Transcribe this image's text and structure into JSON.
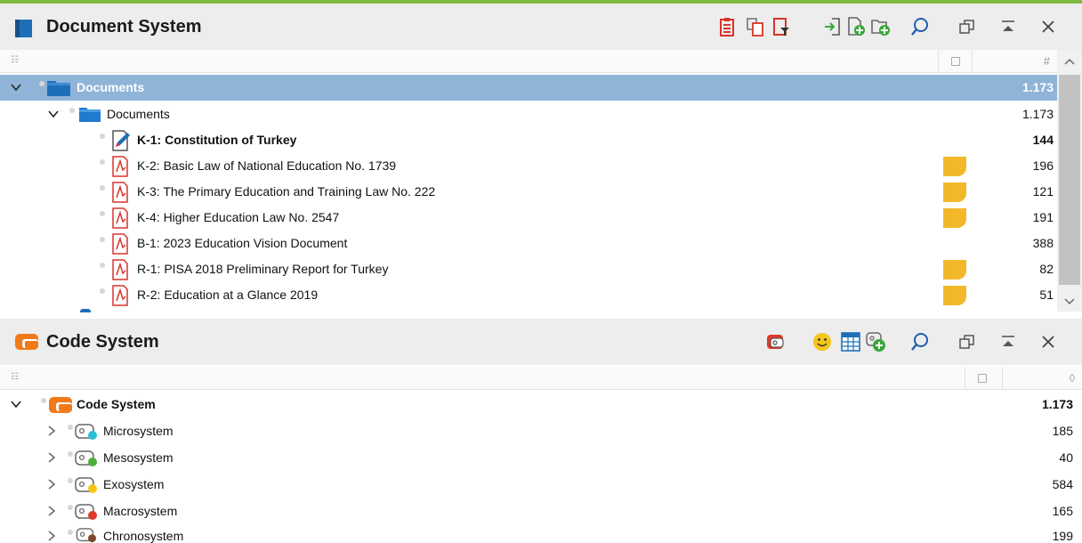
{
  "document_system": {
    "title": "Document System",
    "toolbar": [
      "clipboard-icon",
      "copy-icon",
      "filter-icon",
      "import-icon",
      "new-document-icon",
      "new-set-icon",
      "search-icon",
      "undock-icon",
      "collapse-icon",
      "close-icon"
    ],
    "column_count_header": "#",
    "root": {
      "label": "Documents",
      "count": "1.173"
    },
    "group": {
      "label": "Documents",
      "count": "1.173"
    },
    "documents": [
      {
        "label": "K-1: Constitution of Turkey",
        "count": "144",
        "memo": false,
        "bold": true,
        "icon": "edit-document-icon"
      },
      {
        "label": "K-2: Basic Law of National Education No. 1739",
        "count": "196",
        "memo": true,
        "bold": false,
        "icon": "pdf-icon"
      },
      {
        "label": "K-3: The Primary Education and Training Law No. 222",
        "count": "121",
        "memo": true,
        "bold": false,
        "icon": "pdf-icon"
      },
      {
        "label": "K-4: Higher Education Law No. 2547",
        "count": "191",
        "memo": true,
        "bold": false,
        "icon": "pdf-icon"
      },
      {
        "label": "B-1: 2023 Education Vision Document",
        "count": "388",
        "memo": false,
        "bold": false,
        "icon": "pdf-icon"
      },
      {
        "label": "R-1: PISA 2018 Preliminary Report for Turkey",
        "count": "82",
        "memo": true,
        "bold": false,
        "icon": "pdf-icon"
      },
      {
        "label": "R-2: Education at a Glance 2019",
        "count": "51",
        "memo": true,
        "bold": false,
        "icon": "pdf-icon"
      }
    ]
  },
  "code_system": {
    "title": "Code System",
    "toolbar": [
      "code-icon",
      "smiley-icon",
      "grid-icon",
      "new-code-icon",
      "search-icon",
      "undock-icon",
      "collapse-icon",
      "close-icon"
    ],
    "root": {
      "label": "Code System",
      "count": "1.173"
    },
    "codes": [
      {
        "label": "Microsystem",
        "count": "185",
        "color": "#2bc0d4"
      },
      {
        "label": "Mesosystem",
        "count": "40",
        "color": "#4caf3a"
      },
      {
        "label": "Exosystem",
        "count": "584",
        "color": "#f5c518"
      },
      {
        "label": "Macrosystem",
        "count": "165",
        "color": "#e0382b"
      },
      {
        "label": "Chronosystem",
        "count": "199",
        "color": "#7a4a2a"
      }
    ]
  },
  "colors": {
    "accent_top": "#7dbb42",
    "selected_row": "#8fb4d8",
    "folder_blue": "#1e6fb8",
    "code_orange": "#f07a1a",
    "memo_yellow": "#f3b82a",
    "pdf_red": "#d9342b"
  }
}
